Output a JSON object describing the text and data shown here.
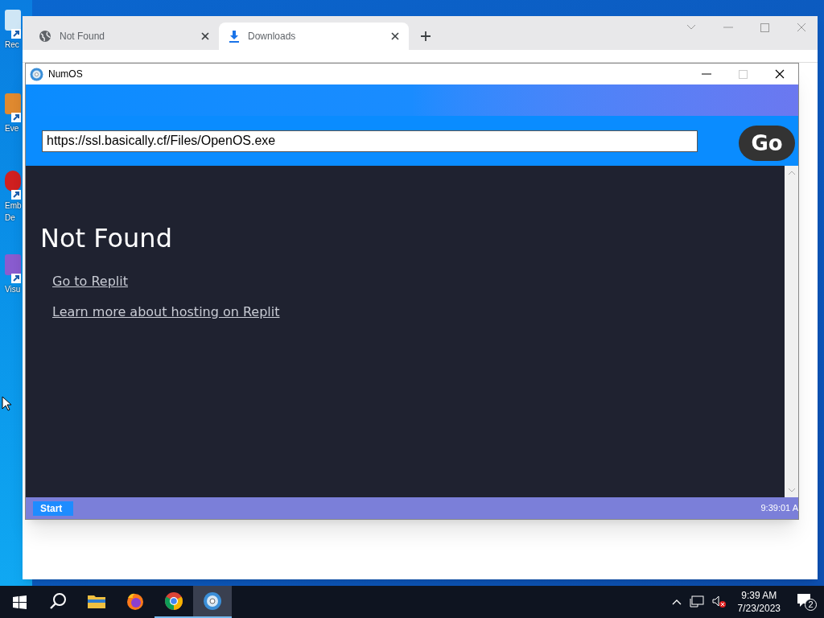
{
  "desktop_icons": [
    {
      "lines": [
        "Rec"
      ]
    },
    {
      "lines": [
        "Eve"
      ]
    },
    {
      "lines": [
        "Emb",
        "De"
      ]
    },
    {
      "lines": [
        "Visu"
      ]
    }
  ],
  "browser": {
    "tabs": [
      {
        "kind": "globe",
        "title": "Not Found",
        "selected": false
      },
      {
        "kind": "download",
        "title": "Downloads",
        "selected": true
      }
    ]
  },
  "app_window": {
    "title": "NumOS",
    "address": {
      "value": "https://ssl.basically.cf/Files/OpenOS.exe"
    },
    "go_button": "Go",
    "page": {
      "heading": "Not Found",
      "links": [
        "Go to Replit",
        "Learn more about hosting on Replit"
      ]
    },
    "footer": {
      "start_button": "Start",
      "clock": "9:39:01 A"
    }
  },
  "taskbar": {
    "apps": [
      {
        "kind": "search",
        "running": false,
        "selected": false
      },
      {
        "kind": "folder",
        "running": false,
        "selected": false
      },
      {
        "kind": "firefox",
        "running": false,
        "selected": false
      },
      {
        "kind": "chrome",
        "running": true,
        "selected": false
      },
      {
        "kind": "disc",
        "running": true,
        "selected": true
      }
    ],
    "time": "9:39 AM",
    "date": "7/23/2023",
    "notifications": "2"
  }
}
